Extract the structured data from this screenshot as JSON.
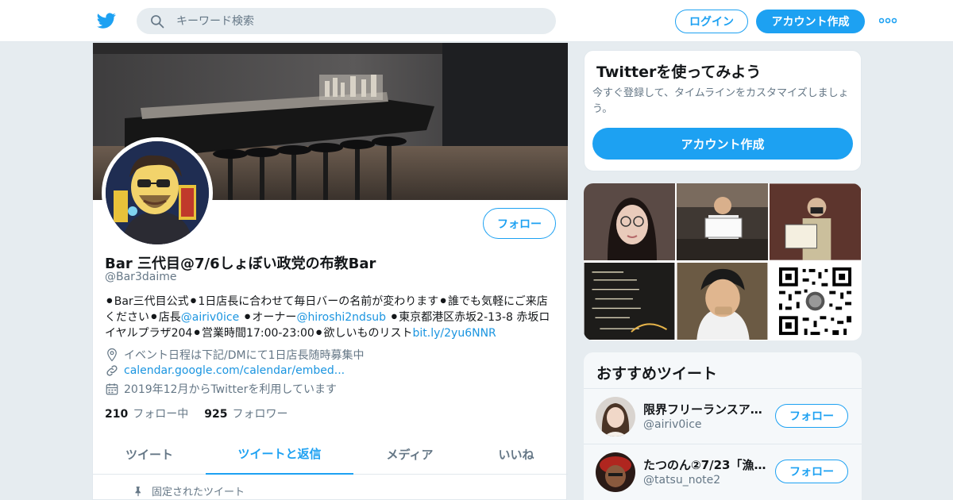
{
  "colors": {
    "brand": "#1da1f2",
    "link": "#1b95e0",
    "muted": "#657786",
    "bg": "#e6ecf0"
  },
  "header": {
    "logo_icon": "twitter-bird-icon",
    "search_placeholder": "キーワード検索",
    "login_label": "ログイン",
    "signup_label": "アカウント作成",
    "more_icon": "more-dots-icon"
  },
  "profile": {
    "follow_label": "フォロー",
    "name": "Bar 三代目@7/6しょぼい政党の布教Bar",
    "handle": "@Bar3daime",
    "bio": {
      "p1": "⚫Bar三代目公式⚫1日店長に合わせて毎日バーの名前が変わります⚫誰でも気軽にご来店ください⚫店長",
      "m1": "@airiv0ice",
      "p2": " ⚫オーナー",
      "m2": "@hiroshi2ndsub",
      "p3": " ⚫東京都港区赤坂2-13-8 赤坂ロイヤルプラザ204⚫営業時間17:00-23:00⚫欲しいものリスト",
      "url": "bit.ly/2yu6NNR"
    },
    "location": "イベント日程は下記/DMにて1日店長随時募集中",
    "website": "calendar.google.com/calendar/embed...",
    "joined": "2019年12月からTwitterを利用しています",
    "following_count": "210",
    "following_label": "フォロー中",
    "followers_count": "925",
    "followers_label": "フォロワー",
    "tabs": [
      {
        "label": "ツイート",
        "active": false
      },
      {
        "label": "ツイートと返信",
        "active": true
      },
      {
        "label": "メディア",
        "active": false
      },
      {
        "label": "いいね",
        "active": false
      }
    ],
    "pinned_label": "固定されたツイート"
  },
  "try_card": {
    "title": "Twitterを使ってみよう",
    "text": "今すぐ登録して、タイムラインをカスタマイズしましょう。",
    "button": "アカウント作成"
  },
  "recommended": {
    "title": "おすすめツイート",
    "users": [
      {
        "name": "限界フリーランスア…",
        "handle": "@airiv0ice",
        "follow": "フォロー"
      },
      {
        "name": "たつのん②7/23「漁…",
        "handle": "@tatsu_note2",
        "follow": "フォロー"
      }
    ]
  }
}
